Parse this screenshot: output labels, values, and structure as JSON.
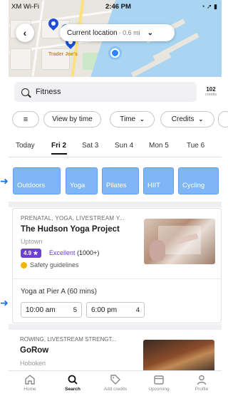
{
  "status_bar": {
    "carrier": "XM Wi-Fi",
    "time": "2:46 PM",
    "right": "◔ ➚ ▮"
  },
  "map": {
    "place_label": "Trader Joe's",
    "location_pill": {
      "label": "Current location",
      "distance": "· 0.6 mi"
    }
  },
  "search": {
    "value": "Fitness",
    "credits_count": "102",
    "credits_label": "credits"
  },
  "filters": {
    "view_by_time": "View by time",
    "time": "Time",
    "credits": "Credits"
  },
  "days": [
    "Today",
    "Fri 2",
    "Sat 3",
    "Sun 4",
    "Mon 5",
    "Tue 6"
  ],
  "categories": [
    "Outdoors",
    "Yoga",
    "Pilates",
    "HIIT",
    "Cycling"
  ],
  "card1": {
    "tags": "PRENATAL, YOGA, LIVESTREAM Y...",
    "title": "The Hudson Yoga Project",
    "neighborhood": "Uptown",
    "rating": "4.9 ★",
    "rating_label": "Excellent",
    "rating_count": "(1000+)",
    "safety": "Safety guidelines",
    "session_title": "Yoga at Pier A (60 mins)",
    "slots": [
      {
        "time": "10:00 am",
        "spots": "5"
      },
      {
        "time": "6:00 pm",
        "spots": "4"
      }
    ]
  },
  "card2": {
    "tags": "ROWING, LIVESTREAM STRENGT...",
    "title": "GoRow",
    "neighborhood": "Hoboken"
  },
  "nav": [
    "Home",
    "Search",
    "Add credits",
    "Upcoming",
    "Profile"
  ],
  "colors": {
    "accent_blue": "#7fb6f8",
    "rating_purple": "#6b3fd8",
    "safety_yellow": "#f2b600"
  },
  "icons": [
    "back-arrow-icon",
    "chevron-down-icon",
    "search-icon",
    "sliders-icon",
    "home-icon",
    "search-icon",
    "tag-icon",
    "calendar-icon",
    "profile-icon"
  ]
}
